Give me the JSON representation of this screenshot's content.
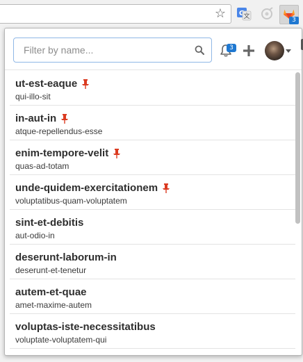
{
  "browser": {
    "extensions": {
      "gitlab_badge": "3"
    }
  },
  "popup": {
    "filter": {
      "placeholder": "Filter by name...",
      "value": ""
    },
    "notifications_count": "3",
    "projects": [
      {
        "name": "ut-est-eaque",
        "namespace": "qui-illo-sit",
        "pinned": true
      },
      {
        "name": "in-aut-in",
        "namespace": "atque-repellendus-esse",
        "pinned": true
      },
      {
        "name": "enim-tempore-velit",
        "namespace": "quas-ad-totam",
        "pinned": true
      },
      {
        "name": "unde-quidem-exercitationem",
        "namespace": "voluptatibus-quam-voluptatem",
        "pinned": true
      },
      {
        "name": "sint-et-debitis",
        "namespace": "aut-odio-in",
        "pinned": false
      },
      {
        "name": "deserunt-laborum-in",
        "namespace": "deserunt-et-tenetur",
        "pinned": false
      },
      {
        "name": "autem-et-quae",
        "namespace": "amet-maxime-autem",
        "pinned": false
      },
      {
        "name": "voluptas-iste-necessitatibus",
        "namespace": "voluptate-voluptatem-qui",
        "pinned": false
      }
    ]
  },
  "colors": {
    "accent": "#1f78d1",
    "pin": "#db3b21"
  },
  "icons": [
    "star-icon",
    "translate-icon",
    "faded-extension-icon",
    "gitlab-icon",
    "search-icon",
    "bell-icon",
    "plus-icon",
    "pin-icon",
    "chevron-down-icon"
  ]
}
